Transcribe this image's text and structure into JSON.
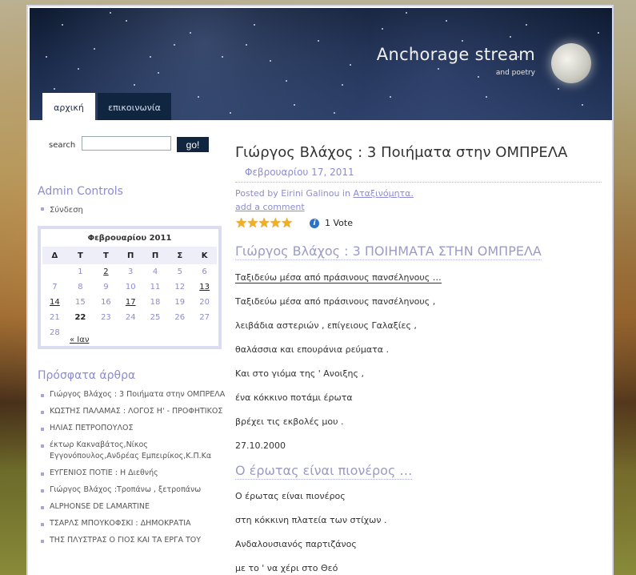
{
  "site": {
    "title": "Anchorage stream",
    "tagline": "and poetry"
  },
  "nav": {
    "tabs": [
      {
        "label": "αρχική"
      },
      {
        "label": "επικοινωνία"
      }
    ]
  },
  "search": {
    "label": "search",
    "value": "",
    "placeholder": "",
    "button": "go!"
  },
  "admin": {
    "title": "Admin Controls",
    "login": "Σύνδεση"
  },
  "calendar": {
    "caption": "Φεβρουαρίου 2011",
    "weekdays": [
      "Δ",
      "Τ",
      "Τ",
      "Π",
      "Π",
      "Σ",
      "Κ"
    ],
    "weeks": [
      [
        "",
        "1",
        "2",
        "3",
        "4",
        "5",
        "6"
      ],
      [
        "7",
        "8",
        "9",
        "10",
        "11",
        "12",
        "13"
      ],
      [
        "14",
        "15",
        "16",
        "17",
        "18",
        "19",
        "20"
      ],
      [
        "21",
        "22",
        "23",
        "24",
        "25",
        "26",
        "27"
      ],
      [
        "28",
        "",
        "",
        "",
        "",
        "",
        ""
      ]
    ],
    "prev": "« Ιαν"
  },
  "recent": {
    "title": "Πρόσφατα άρθρα",
    "items": [
      "Γιώργος Βλάχος : 3 Ποιήματα στην ΟΜΠΡΕΛΑ",
      "ΚΩΣΤΗΣ ΠΑΛΑΜΑΣ : ΛΟΓΟΣ Η' - ΠΡΟΦΗΤΙΚΟΣ",
      "ΗΛΙΑΣ ΠΕΤΡΟΠΟΥΛΟΣ",
      "έκτωρ Κακναβάτος,Νίκος Εγγονόπουλος,Ανδρέας Εμπειρίκος,Κ.Π.Κα",
      "ΕΥΓΕΝΙΟΣ ΠΟΤΙΕ : Η Διεθνής",
      "Γιώργος Βλάχος :Τροπάνω , ξετροπάνω",
      "ALPHONSE DE LAMARTINE",
      "ΤΣΑΡΛΣ ΜΠΟΥΚΟΦΣΚΙ : ΔΗΜΟΚΡΑΤΙΑ",
      "ΤΗΣ ΠΛΥΣΤΡΑΣ Ο ΓΙΟΣ ΚΑΙ ΤΑ ΕΡΓΑ ΤΟΥ"
    ]
  },
  "post": {
    "title": "Γιώργος Βλάχος : 3 Ποιήματα στην ΟΜΠΡΕΛΑ",
    "date": "Φεβρουαρίου 17, 2011",
    "meta_prefix": "Posted by Eirini Galinou in ",
    "category": "Αταξινόμητα.",
    "add_comment": "add a comment",
    "rating_stars": 5,
    "votes": "1 Vote",
    "poem1_title": "Γιώργος Βλάχος : 3 ΠΟΙΗΜΑΤΑ ΣΤΗΝ ΟΜΠΡΕΛΑ",
    "poem1_first": "Ταξιδεύω μέσα από πράσινους πανσέληνους …",
    "poem1_lines": [
      "Ταξιδεύω μέσα από πράσινους πανσέληνους ,",
      "λειβάδια αστεριών , επίγειους Γαλαξίες ,",
      "θαλάσσια και επουράνια ρεύματα .",
      "Και στο γιόμα της ' Ανοιξης ,",
      "ένα κόκκινο ποτάμι έρωτα",
      "βρέχει τις εκβολές μου .",
      "27.10.2000"
    ],
    "poem2_title": "Ο έρωτας είναι πιονέρος …",
    "poem2_lines": [
      "Ο έρωτας είναι πιονέρος",
      "στη κόκκινη πλατεία των στίχων .",
      "Ανδαλουσιανός παρτιζάνος",
      "με το ' να χέρι στο Θεό"
    ]
  }
}
